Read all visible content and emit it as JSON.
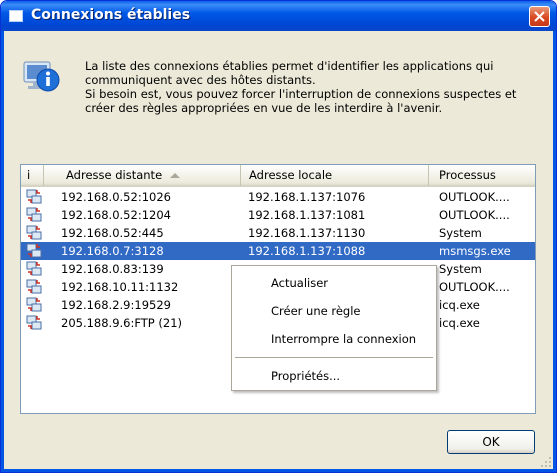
{
  "window": {
    "title": "Connexions établies"
  },
  "info": {
    "lines": [
      "La liste des connexions établies permet d'identifier les applications qui",
      "communiquent avec des hôtes distants.",
      "Si besoin est, vous pouvez forcer l'interruption de connexions suspectes et",
      "créer des règles appropriées en vue de les interdire à l'avenir."
    ]
  },
  "table": {
    "headers": {
      "i": "i",
      "remote": "Adresse distante",
      "local": "Adresse locale",
      "process": "Processus"
    },
    "rows": [
      {
        "remote": "192.168.0.52:1026",
        "local": "192.168.1.137:1076",
        "process": "OUTLOOK...."
      },
      {
        "remote": "192.168.0.52:1204",
        "local": "192.168.1.137:1081",
        "process": "OUTLOOK...."
      },
      {
        "remote": "192.168.0.52:445",
        "local": "192.168.1.137:1130",
        "process": "System"
      },
      {
        "remote": "192.168.0.7:3128",
        "local": "192.168.1.137:1088",
        "process": "msmsgs.exe",
        "selected": true
      },
      {
        "remote": "192.168.0.83:139",
        "local": "",
        "process": "System"
      },
      {
        "remote": "192.168.10.11:1132",
        "local": "",
        "process": "OUTLOOK...."
      },
      {
        "remote": "192.168.2.9:19529",
        "local": "",
        "process": "icq.exe"
      },
      {
        "remote": "205.188.9.6:FTP (21)",
        "local": "",
        "process": "icq.exe"
      }
    ]
  },
  "context_menu": {
    "refresh": "Actualiser",
    "create_rule": "Créer une règle",
    "terminate": "Interrompre la connexion",
    "properties": "Propriétés..."
  },
  "buttons": {
    "ok": "OK"
  },
  "colors": {
    "titlebar": "#0058e6",
    "selection": "#316ac5",
    "dialog_bg": "#ece9d8"
  }
}
